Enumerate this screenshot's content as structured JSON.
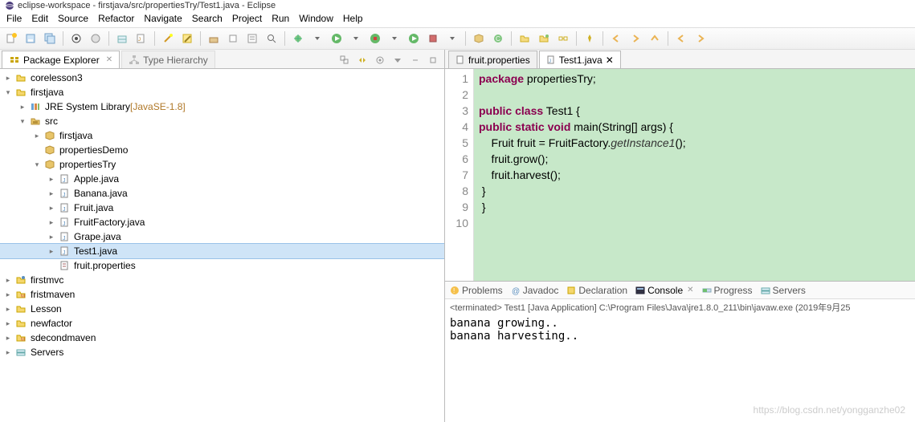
{
  "window": {
    "title": "eclipse-workspace - firstjava/src/propertiesTry/Test1.java - Eclipse"
  },
  "menu": [
    "File",
    "Edit",
    "Source",
    "Refactor",
    "Navigate",
    "Search",
    "Project",
    "Run",
    "Window",
    "Help"
  ],
  "explorer": {
    "tabs": {
      "active": "Package Explorer",
      "inactive": "Type Hierarchy"
    },
    "tree": {
      "corelesson3": "corelesson3",
      "firstjava": "firstjava",
      "jre": "JRE System Library",
      "jre_hint": "[JavaSE-1.8]",
      "src": "src",
      "pkg_firstjava": "firstjava",
      "pkg_propertiesDemo": "propertiesDemo",
      "pkg_propertiesTry": "propertiesTry",
      "files": [
        "Apple.java",
        "Banana.java",
        "Fruit.java",
        "FruitFactory.java",
        "Grape.java",
        "Test1.java",
        "fruit.properties"
      ],
      "firstmvc": "firstmvc",
      "fristmaven": "fristmaven",
      "Lesson": "Lesson",
      "newfactor": "newfactor",
      "sdecondmaven": "sdecondmaven",
      "Servers": "Servers"
    }
  },
  "editor": {
    "tabs": {
      "inactive": "fruit.properties",
      "active": "Test1.java"
    },
    "lines": [
      "1",
      "2",
      "3",
      "4",
      "5",
      "6",
      "7",
      "8",
      "9",
      "10"
    ],
    "code": {
      "l1a": "package",
      "l1b": " propertiesTry;",
      "l3a": "public",
      "l3b": "class",
      "l3c": " Test1 {",
      "l4a": "public",
      "l4b": "static",
      "l4c": "void",
      "l4d": " main(String[] args) {",
      "l5": "    Fruit fruit = FruitFactory.",
      "l5b": "getInstance1",
      "l5c": "();",
      "l6": "    fruit.grow();",
      "l7": "    fruit.harvest();",
      "l8": " }",
      "l9": " }"
    }
  },
  "bottom": {
    "tabs": [
      "Problems",
      "Javadoc",
      "Declaration",
      "Console",
      "Progress",
      "Servers"
    ],
    "active_x": "✕",
    "status": "<terminated> Test1 [Java Application] C:\\Program Files\\Java\\jre1.8.0_211\\bin\\javaw.exe (2019年9月25",
    "output": "banana growing..\nbanana harvesting.."
  },
  "watermark": "https://blog.csdn.net/yongganzhe02"
}
